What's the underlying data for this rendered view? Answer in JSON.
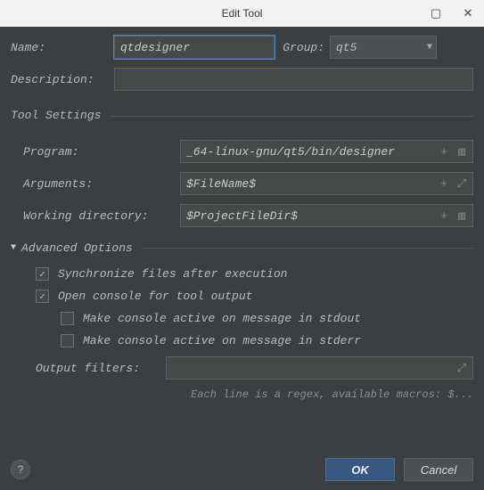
{
  "window": {
    "title": "Edit Tool"
  },
  "fields": {
    "name_label": "Name:",
    "name_value": "qtdesigner",
    "group_label": "Group:",
    "group_value": "qt5",
    "description_label": "Description:",
    "description_value": ""
  },
  "tool_settings": {
    "title": "Tool Settings",
    "program_label": "Program:",
    "program_value": "_64-linux-gnu/qt5/bin/designer",
    "arguments_label": "Arguments:",
    "arguments_value": "$FileName$",
    "workdir_label": "Working directory:",
    "workdir_value": "$ProjectFileDir$"
  },
  "advanced": {
    "title": "Advanced Options",
    "sync_label": "Synchronize files after execution",
    "sync_checked": true,
    "open_console_label": "Open console for tool output",
    "open_console_checked": true,
    "stdout_label": "Make console active on message in stdout",
    "stdout_checked": false,
    "stderr_label": "Make console active on message in stderr",
    "stderr_checked": false,
    "filters_label": "Output filters:",
    "filters_value": "",
    "hint": "Each line is a regex, available macros: $..."
  },
  "buttons": {
    "ok": "OK",
    "cancel": "Cancel"
  }
}
